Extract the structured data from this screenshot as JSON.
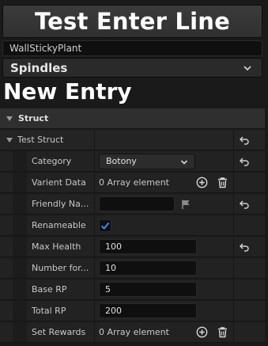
{
  "header": {
    "title_button": "Test Enter Line",
    "name_field_value": "WallStickyPlant",
    "combo_selected": "Spindles"
  },
  "new_entry_heading": "New Entry",
  "details": {
    "section_label": "Struct",
    "group_label": "Test Struct",
    "rows": {
      "category": {
        "label": "Category",
        "value": "Botony"
      },
      "varient_data": {
        "label": "Varient Data",
        "value": "0 Array element"
      },
      "friendly_name": {
        "label": "Friendly Na...",
        "value": ""
      },
      "renameable": {
        "label": "Renameable",
        "checked": true
      },
      "max_health": {
        "label": "Max Health",
        "value": "100"
      },
      "number_for": {
        "label": "Number for...",
        "value": "10"
      },
      "base_rp": {
        "label": "Base RP",
        "value": "5"
      },
      "total_rp": {
        "label": "Total RP",
        "value": "200"
      },
      "set_rewards": {
        "label": "Set Rewards",
        "value": "0 Array element"
      }
    }
  },
  "icons": [
    "chevron-down-icon",
    "reset-arrow-icon",
    "add-circle-icon",
    "trash-icon",
    "flag-icon",
    "checkmark-icon",
    "collapse-triangle-icon"
  ],
  "colors": {
    "background": "#1a1a1a",
    "row": "#222222",
    "checkmark": "#2f8ff0",
    "text": "#c8c8c8"
  }
}
